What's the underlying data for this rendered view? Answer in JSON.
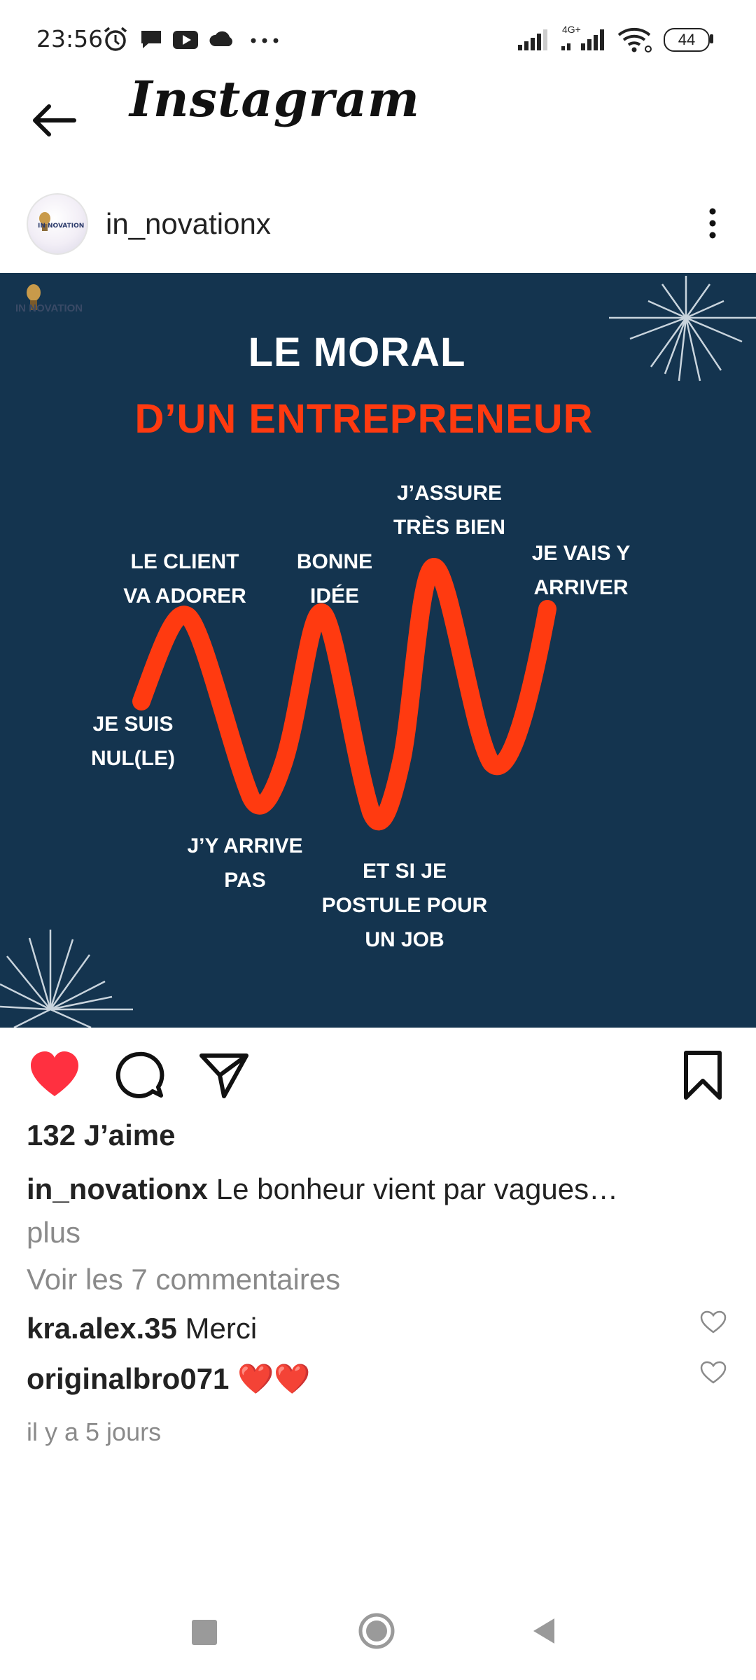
{
  "status_bar": {
    "time": "23:56",
    "network": "4G+",
    "battery": "44",
    "icons": [
      "alarm-icon",
      "chat-bubble-icon",
      "youtube-icon",
      "cloud-icon",
      "more-dots-icon",
      "signal-icon",
      "signal-4g-icon",
      "wifi-icon",
      "battery-icon"
    ]
  },
  "app_bar": {
    "title": "Instagram",
    "back_icon": "arrow-left-icon"
  },
  "post": {
    "username": "in_novationx",
    "avatar_text": "IN NOVATION",
    "image": {
      "logo_text": "IN NOVATION",
      "title_line1": "LE MORAL",
      "title_line2": "D’UN ENTREPRENEUR",
      "colors": {
        "background": "#14344f",
        "accent": "#ff3a10",
        "text": "#ffffff"
      },
      "labels": {
        "nul": "JE SUIS\nNUL(LE)",
        "client": "LE CLIENT\nVA ADORER",
        "arrive_pas": "J’Y ARRIVE\nPAS",
        "bonne_idee": "BONNE\nIDÉE",
        "postule": "ET SI JE\nPOSTULE POUR\nUN JOB",
        "assure": "J’ASSURE\nTRÈS BIEN",
        "vais_arriver": "JE VAIS Y\nARRIVER"
      }
    },
    "actions": {
      "like": "heart-filled-icon",
      "comment": "comment-icon",
      "share": "send-icon",
      "save": "bookmark-icon"
    },
    "likes": "132 J’aime",
    "caption": {
      "username": "in_novationx",
      "text": "Le bonheur vient par vagues…",
      "more": "plus"
    },
    "view_comments": "Voir les 7 commentaires",
    "comments": [
      {
        "username": "kra.alex.35",
        "text": "Merci"
      },
      {
        "username": "originalbro071",
        "text": "❤️❤️"
      }
    ],
    "timestamp": "il y a 5 jours"
  },
  "nav_bar": {
    "icons": [
      "recents-square-icon",
      "home-circle-icon",
      "back-triangle-icon"
    ]
  }
}
